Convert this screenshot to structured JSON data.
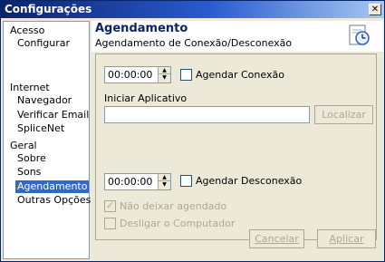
{
  "window": {
    "title": "Configurações",
    "close_symbol": "✕"
  },
  "sidebar": {
    "groups": [
      {
        "label": "Acesso",
        "items": [
          "Configurar"
        ]
      },
      {
        "label": "Internet",
        "items": [
          "Navegador",
          "Verificar Email",
          "SpliceNet"
        ]
      },
      {
        "label": "Geral",
        "items": [
          "Sobre",
          "Sons",
          "Agendamento",
          "Outras Opções"
        ]
      }
    ],
    "selected": "Agendamento"
  },
  "header": {
    "title": "Agendamento",
    "subtitle": "Agendamento de Conexão/Desconexão",
    "icon": "clock-document-icon"
  },
  "schedule": {
    "connect_time": "00:00:00",
    "connect_label": "Agendar Conexão",
    "connect_checked": false,
    "app_label": "Iniciar Aplicativo",
    "app_value": "",
    "locate_button": "Localizar",
    "disconnect_time": "00:00:00",
    "disconnect_label": "Agendar Desconexão",
    "disconnect_checked": false,
    "keep_label": "Não deixar agendado",
    "keep_checked": true,
    "shutdown_label": "Desligar o Computador",
    "shutdown_checked": false
  },
  "footer": {
    "cancel_label": "Cancelar",
    "apply_label": "Aplicar"
  },
  "colors": {
    "accent": "#0a246a",
    "selection": "#316ac5",
    "face": "#ece9d8",
    "disabled": "#aca899"
  }
}
